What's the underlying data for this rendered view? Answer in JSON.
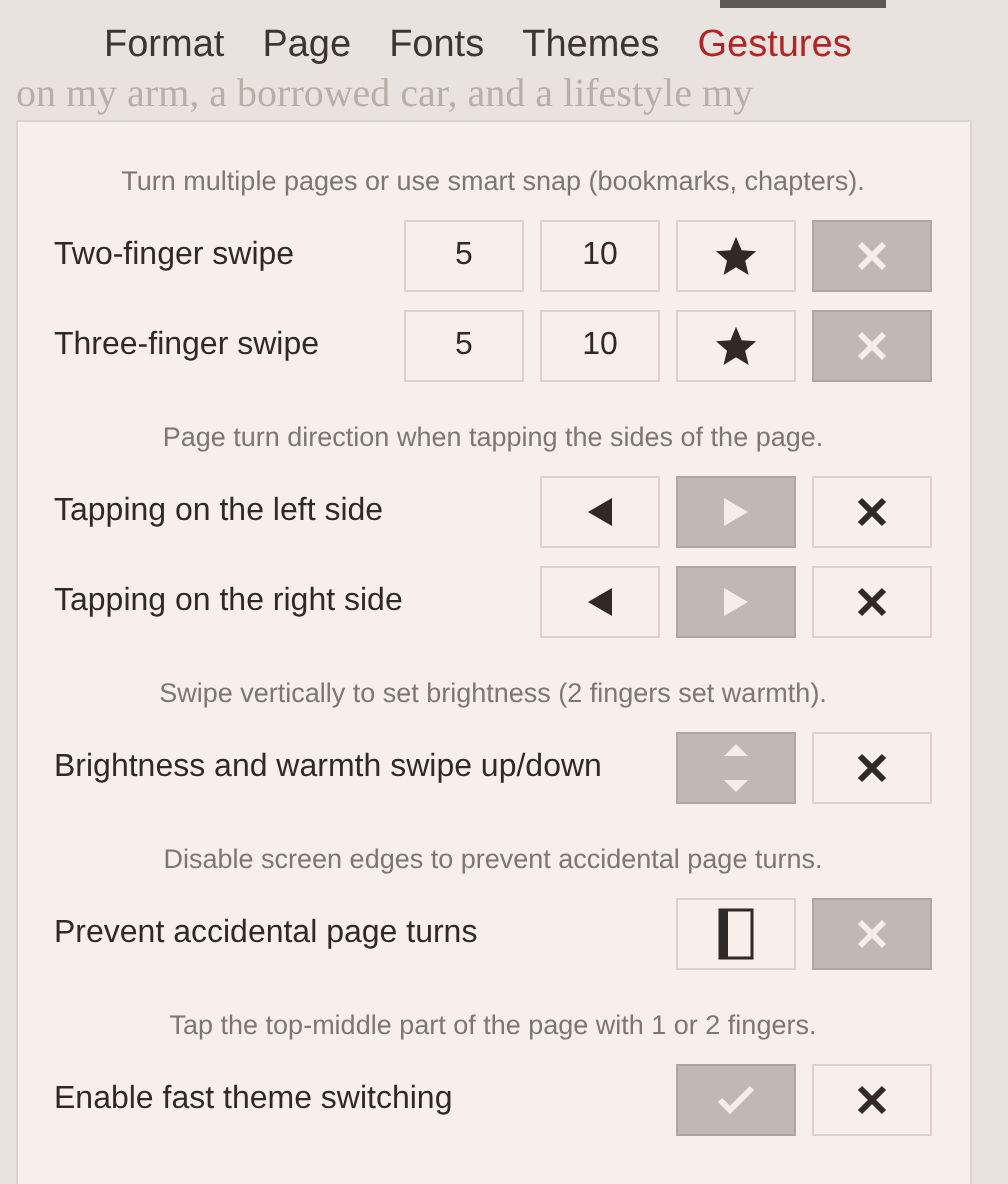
{
  "tabs": [
    {
      "label": "Format",
      "selected": false
    },
    {
      "label": "Page",
      "selected": false
    },
    {
      "label": "Fonts",
      "selected": false
    },
    {
      "label": "Themes",
      "selected": false
    },
    {
      "label": "Gestures",
      "selected": true
    }
  ],
  "background_text": "on my arm, a borrowed car, and a lifestyle my",
  "sections": [
    {
      "hint": "Turn multiple pages or use smart snap (bookmarks, chapters).",
      "rows": [
        {
          "label": "Two-finger swipe",
          "options": [
            {
              "kind": "number",
              "text": "5",
              "selected": false
            },
            {
              "kind": "number",
              "text": "10",
              "selected": false
            },
            {
              "kind": "star",
              "selected": false
            },
            {
              "kind": "clear",
              "selected": true
            }
          ]
        },
        {
          "label": "Three-finger swipe",
          "options": [
            {
              "kind": "number",
              "text": "5",
              "selected": false
            },
            {
              "kind": "number",
              "text": "10",
              "selected": false
            },
            {
              "kind": "star",
              "selected": false
            },
            {
              "kind": "clear",
              "selected": true
            }
          ]
        }
      ]
    },
    {
      "hint": "Page turn direction when tapping the sides of the page.",
      "rows": [
        {
          "label": "Tapping on the left side",
          "options": [
            {
              "kind": "left",
              "selected": false
            },
            {
              "kind": "right",
              "selected": true
            },
            {
              "kind": "clear",
              "selected": false
            }
          ]
        },
        {
          "label": "Tapping on the right side",
          "options": [
            {
              "kind": "left",
              "selected": false
            },
            {
              "kind": "right",
              "selected": true
            },
            {
              "kind": "clear",
              "selected": false
            }
          ]
        }
      ]
    },
    {
      "hint": "Swipe vertically to set brightness (2 fingers set warmth).",
      "rows": [
        {
          "label": "Brightness and warmth swipe up/down",
          "options": [
            {
              "kind": "vertical",
              "selected": true
            },
            {
              "kind": "clear",
              "selected": false
            }
          ]
        }
      ]
    },
    {
      "hint": "Disable screen edges to prevent accidental page turns.",
      "rows": [
        {
          "label": "Prevent accidental page turns",
          "options": [
            {
              "kind": "edges",
              "selected": false
            },
            {
              "kind": "clear",
              "selected": true
            }
          ]
        }
      ]
    },
    {
      "hint": "Tap the top-middle part of the page with 1 or 2 fingers.",
      "rows": [
        {
          "label": "Enable fast theme switching",
          "options": [
            {
              "kind": "check",
              "selected": true
            },
            {
              "kind": "clear",
              "selected": false
            }
          ]
        }
      ]
    }
  ]
}
